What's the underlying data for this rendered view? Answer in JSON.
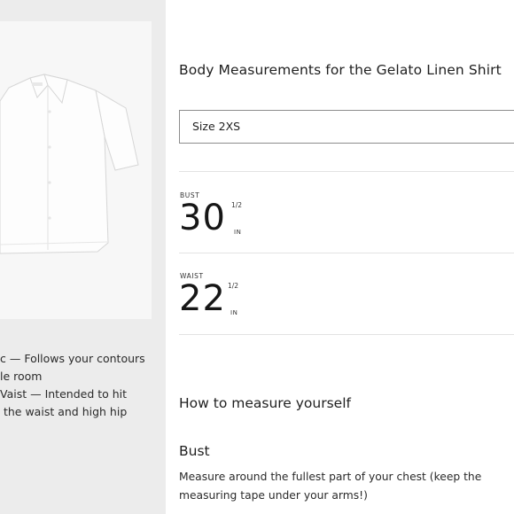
{
  "product": {
    "fit_notes": [
      "c — Follows your contours",
      "le room",
      "Vaist — Intended to hit",
      " the waist and high hip"
    ]
  },
  "main": {
    "title": "Body Measurements for the Gelato Linen Shirt",
    "size_select": {
      "value": "Size 2XS"
    },
    "measurements": [
      {
        "label": "BUST",
        "value": "30",
        "fraction": "1/2",
        "unit": "IN"
      },
      {
        "label": "WAIST",
        "value": "22",
        "fraction": "1/2",
        "unit": "IN"
      }
    ],
    "how_to_heading": "How to measure yourself",
    "bust_heading": "Bust",
    "bust_instructions": "Measure around the fullest part of your chest (keep the measuring tape under your arms!)"
  }
}
